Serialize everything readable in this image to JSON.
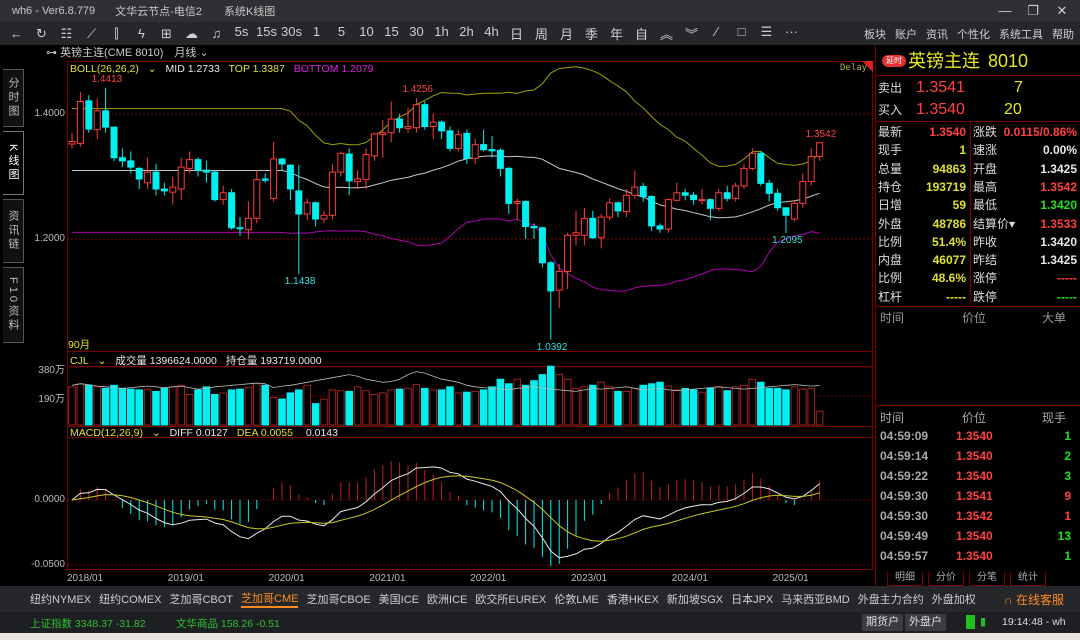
{
  "titlebar": {
    "app": "wh6  -  Ver6.8.779",
    "node": "文华云节点-电信2",
    "window": "系统K线图",
    "minimize": "—",
    "restore": "❐",
    "close": "✕"
  },
  "toolbar": {
    "icons": [
      {
        "name": "back-arrow-icon",
        "glyph": "←"
      },
      {
        "name": "refresh-icon",
        "glyph": "↻"
      },
      {
        "name": "list-icon",
        "glyph": "☷"
      },
      {
        "name": "line-chart-icon",
        "glyph": "⟋"
      },
      {
        "name": "candlestick-icon",
        "glyph": "⫿"
      },
      {
        "name": "lightning-icon",
        "glyph": "ϟ"
      },
      {
        "name": "calculator-icon",
        "glyph": "⊞"
      },
      {
        "name": "cloud-icon",
        "glyph": "☁"
      },
      {
        "name": "bell-icon",
        "glyph": "♫"
      }
    ],
    "periods": [
      "5s",
      "15s",
      "30s",
      "1",
      "5",
      "10",
      "15",
      "30",
      "1h",
      "2h",
      "4h",
      "日",
      "周",
      "月",
      "季",
      "年",
      "自"
    ],
    "tools": [
      {
        "name": "double-up-icon",
        "glyph": "︽"
      },
      {
        "name": "double-down-icon",
        "glyph": "︾"
      },
      {
        "name": "draw-line-icon",
        "glyph": "⁄"
      },
      {
        "name": "rectangle-icon",
        "glyph": "□"
      },
      {
        "name": "layout-icon",
        "glyph": "☰"
      },
      {
        "name": "more-icon",
        "glyph": "···"
      }
    ],
    "menu": [
      "板块",
      "账户",
      "资讯",
      "个性化",
      "系统工具",
      "帮助"
    ]
  },
  "symbol_row": {
    "link_icon": "⊶",
    "name": "英镑主连(CME 8010)",
    "period": "月线"
  },
  "side_tabs": [
    "分时图",
    "K线图",
    "资讯链",
    "F10资料"
  ],
  "chart_data": {
    "type": "candlestick",
    "title": "英镑主连(CME 8010) 月线",
    "period_count_label": "90月",
    "delay_label": "Delay",
    "x_ticks": [
      {
        "i": 0,
        "label": "2018/01"
      },
      {
        "i": 12,
        "label": "2019/01"
      },
      {
        "i": 24,
        "label": "2020/01"
      },
      {
        "i": 36,
        "label": "2021/01"
      },
      {
        "i": 48,
        "label": "2022/01"
      },
      {
        "i": 60,
        "label": "2023/01"
      },
      {
        "i": 72,
        "label": "2024/01"
      },
      {
        "i": 84,
        "label": "2025/01"
      }
    ],
    "price_axis": {
      "ticks": [
        "1.4000",
        "1.2000"
      ],
      "tick_values": [
        1.4,
        1.2
      ]
    },
    "volume_axis": {
      "ticks": [
        "380万",
        "190万"
      ],
      "tick_values": [
        380,
        190
      ]
    },
    "macd_axis": {
      "ticks": [
        "0.0000",
        "-0.0500"
      ],
      "tick_values": [
        0,
        -0.05
      ]
    },
    "boll_legend": {
      "name": "BOLL(26,26,2)",
      "mid": "MID 1.2733",
      "top": "TOP 1.3387",
      "bottom": "BOTTOM 1.2079"
    },
    "vol_legend": {
      "name": "CJL",
      "volume": "成交量 1396624.0000",
      "oi": "持仓量 193719.0000"
    },
    "macd_legend": {
      "name": "MACD(12,26,9)",
      "diff": "DIFF 0.0127",
      "dea": "DEA 0.0055",
      "macd": "0.0143"
    },
    "annotations": [
      {
        "i": 4,
        "label": "1.4413",
        "type": "high"
      },
      {
        "i": 41,
        "label": "1.4256",
        "type": "high"
      },
      {
        "i": 89,
        "label": "1.3542",
        "type": "high"
      },
      {
        "i": 27,
        "label": "1.1438",
        "type": "low"
      },
      {
        "i": 57,
        "label": "1.0392",
        "type": "low"
      },
      {
        "i": 85,
        "label": "1.2095",
        "type": "low"
      }
    ],
    "ohlc": [
      [
        1.352,
        1.37,
        1.345,
        1.356
      ],
      [
        1.353,
        1.435,
        1.348,
        1.42
      ],
      [
        1.421,
        1.43,
        1.37,
        1.376
      ],
      [
        1.375,
        1.425,
        1.36,
        1.405
      ],
      [
        1.405,
        1.4413,
        1.37,
        1.379
      ],
      [
        1.379,
        1.38,
        1.325,
        1.33
      ],
      [
        1.33,
        1.345,
        1.315,
        1.325
      ],
      [
        1.325,
        1.34,
        1.305,
        1.315
      ],
      [
        1.313,
        1.315,
        1.28,
        1.296
      ],
      [
        1.29,
        1.33,
        1.28,
        1.307
      ],
      [
        1.307,
        1.32,
        1.27,
        1.28
      ],
      [
        1.28,
        1.29,
        1.27,
        1.277
      ],
      [
        1.275,
        1.3,
        1.255,
        1.283
      ],
      [
        1.28,
        1.33,
        1.262,
        1.315
      ],
      [
        1.313,
        1.34,
        1.305,
        1.327
      ],
      [
        1.327,
        1.33,
        1.3,
        1.31
      ],
      [
        1.31,
        1.325,
        1.29,
        1.307
      ],
      [
        1.307,
        1.31,
        1.26,
        1.263
      ],
      [
        1.263,
        1.285,
        1.255,
        1.274
      ],
      [
        1.274,
        1.28,
        1.215,
        1.218
      ],
      [
        1.218,
        1.235,
        1.205,
        1.217
      ],
      [
        1.215,
        1.26,
        1.2,
        1.233
      ],
      [
        1.233,
        1.31,
        1.225,
        1.295
      ],
      [
        1.296,
        1.305,
        1.29,
        1.294
      ],
      [
        1.265,
        1.355,
        1.26,
        1.328
      ],
      [
        1.328,
        1.33,
        1.31,
        1.32
      ],
      [
        1.318,
        1.32,
        1.262,
        1.28
      ],
      [
        1.277,
        1.318,
        1.1438,
        1.24
      ],
      [
        1.24,
        1.265,
        1.23,
        1.258
      ],
      [
        1.258,
        1.26,
        1.22,
        1.232
      ],
      [
        1.232,
        1.245,
        1.225,
        1.238
      ],
      [
        1.238,
        1.32,
        1.232,
        1.307
      ],
      [
        1.307,
        1.34,
        1.3,
        1.337
      ],
      [
        1.336,
        1.345,
        1.27,
        1.293
      ],
      [
        1.292,
        1.31,
        1.28,
        1.296
      ],
      [
        1.295,
        1.345,
        1.28,
        1.335
      ],
      [
        1.333,
        1.37,
        1.325,
        1.368
      ],
      [
        1.367,
        1.39,
        1.33,
        1.37
      ],
      [
        1.37,
        1.42,
        1.355,
        1.392
      ],
      [
        1.392,
        1.4,
        1.37,
        1.378
      ],
      [
        1.377,
        1.41,
        1.37,
        1.38
      ],
      [
        1.378,
        1.4256,
        1.37,
        1.415
      ],
      [
        1.415,
        1.42,
        1.375,
        1.38
      ],
      [
        1.38,
        1.4,
        1.36,
        1.387
      ],
      [
        1.387,
        1.39,
        1.36,
        1.373
      ],
      [
        1.373,
        1.38,
        1.34,
        1.345
      ],
      [
        1.345,
        1.375,
        1.34,
        1.367
      ],
      [
        1.369,
        1.375,
        1.32,
        1.329
      ],
      [
        1.329,
        1.36,
        1.32,
        1.351
      ],
      [
        1.351,
        1.375,
        1.34,
        1.343
      ],
      [
        1.343,
        1.365,
        1.33,
        1.341
      ],
      [
        1.342,
        1.345,
        1.3,
        1.313
      ],
      [
        1.313,
        1.315,
        1.24,
        1.257
      ],
      [
        1.257,
        1.265,
        1.23,
        1.26
      ],
      [
        1.26,
        1.262,
        1.2,
        1.22
      ],
      [
        1.22,
        1.225,
        1.2,
        1.218
      ],
      [
        1.218,
        1.22,
        1.155,
        1.162
      ],
      [
        1.162,
        1.165,
        1.0392,
        1.117
      ],
      [
        1.118,
        1.16,
        1.09,
        1.148
      ],
      [
        1.148,
        1.21,
        1.12,
        1.206
      ],
      [
        1.206,
        1.245,
        1.19,
        1.21
      ],
      [
        1.206,
        1.25,
        1.19,
        1.233
      ],
      [
        1.233,
        1.245,
        1.2,
        1.202
      ],
      [
        1.202,
        1.24,
        1.185,
        1.235
      ],
      [
        1.235,
        1.265,
        1.23,
        1.258
      ],
      [
        1.258,
        1.26,
        1.235,
        1.245
      ],
      [
        1.244,
        1.28,
        1.235,
        1.27
      ],
      [
        1.27,
        1.31,
        1.265,
        1.283
      ],
      [
        1.284,
        1.29,
        1.26,
        1.268
      ],
      [
        1.268,
        1.27,
        1.213,
        1.221
      ],
      [
        1.221,
        1.225,
        1.21,
        1.216
      ],
      [
        1.216,
        1.265,
        1.21,
        1.263
      ],
      [
        1.262,
        1.29,
        1.26,
        1.274
      ],
      [
        1.274,
        1.28,
        1.262,
        1.27
      ],
      [
        1.27,
        1.275,
        1.255,
        1.263
      ],
      [
        1.262,
        1.28,
        1.255,
        1.263
      ],
      [
        1.263,
        1.265,
        1.23,
        1.249
      ],
      [
        1.249,
        1.28,
        1.245,
        1.274
      ],
      [
        1.274,
        1.285,
        1.26,
        1.265
      ],
      [
        1.265,
        1.29,
        1.26,
        1.285
      ],
      [
        1.285,
        1.32,
        1.28,
        1.313
      ],
      [
        1.313,
        1.345,
        1.31,
        1.337
      ],
      [
        1.337,
        1.34,
        1.285,
        1.289
      ],
      [
        1.289,
        1.295,
        1.26,
        1.273
      ],
      [
        1.273,
        1.28,
        1.245,
        1.25
      ],
      [
        1.25,
        1.25,
        1.2095,
        1.238
      ],
      [
        1.232,
        1.262,
        1.228,
        1.257
      ],
      [
        1.257,
        1.305,
        1.25,
        1.292
      ],
      [
        1.292,
        1.345,
        1.285,
        1.332
      ],
      [
        1.332,
        1.3542,
        1.325,
        1.354
      ]
    ],
    "volume_wan": [
      250,
      270,
      260,
      250,
      240,
      260,
      240,
      235,
      230,
      235,
      220,
      240,
      250,
      260,
      200,
      230,
      250,
      200,
      210,
      230,
      235,
      245,
      270,
      260,
      180,
      170,
      210,
      230,
      260,
      140,
      170,
      230,
      225,
      220,
      250,
      225,
      200,
      210,
      230,
      235,
      240,
      265,
      240,
      230,
      230,
      250,
      210,
      215,
      220,
      230,
      250,
      300,
      270,
      300,
      260,
      290,
      330,
      385,
      330,
      300,
      240,
      250,
      260,
      280,
      250,
      220,
      220,
      240,
      260,
      270,
      280,
      255,
      230,
      240,
      230,
      215,
      240,
      250,
      225,
      250,
      260,
      300,
      280,
      240,
      240,
      230,
      250,
      235,
      240,
      90
    ],
    "open_interest_wan": [
      260,
      270,
      265,
      255,
      250,
      245,
      240,
      245,
      250,
      255,
      250,
      245,
      250,
      255,
      245,
      235,
      240,
      250,
      255,
      260,
      265,
      270,
      275,
      270,
      245,
      255,
      260,
      270,
      280,
      290,
      300,
      310,
      320,
      330,
      320,
      300,
      290,
      280,
      285,
      300,
      330,
      350,
      340,
      320,
      300,
      290,
      280,
      260,
      250,
      245,
      240,
      235,
      230,
      240,
      245,
      250,
      240,
      235,
      230,
      225,
      220,
      230,
      240,
      235,
      240,
      245,
      250,
      240,
      230,
      235,
      240,
      230,
      225,
      230,
      235,
      240,
      245,
      250,
      245,
      240,
      235,
      240,
      245,
      250,
      255,
      260,
      265,
      260,
      255,
      260
    ]
  },
  "quote": {
    "badge": "延时",
    "name": "英镑主连",
    "code": "8010",
    "ask_label": "卖出",
    "ask_price": "1.3541",
    "ask_qty": "7",
    "bid_label": "买入",
    "bid_price": "1.3540",
    "bid_qty": "20",
    "stats": [
      {
        "l1": "最新",
        "v1": "1.3540",
        "c1": "#ff4040",
        "l2": "涨跌",
        "v2": "0.0115/0.86%",
        "c2": "#ff4040"
      },
      {
        "l1": "现手",
        "v1": "1",
        "c1": "#e0e030",
        "l2": "速涨",
        "v2": "0.00%",
        "c2": "#e8e8e8"
      },
      {
        "l1": "总量",
        "v1": "94863",
        "c1": "#e0e030",
        "l2": "开盘",
        "v2": "1.3425",
        "c2": "#e8e8e8"
      },
      {
        "l1": "持仓",
        "v1": "193719",
        "c1": "#e0e030",
        "l2": "最高",
        "v2": "1.3542",
        "c2": "#ff4040"
      },
      {
        "l1": "日增",
        "v1": "59",
        "c1": "#e0e030",
        "l2": "最低",
        "v2": "1.3420",
        "c2": "#20e020"
      },
      {
        "l1": "外盘",
        "v1": "48786",
        "c1": "#e0e030",
        "l2": "结算价▾",
        "v2": "1.3533",
        "c2": "#ff4040"
      },
      {
        "l1": "比例",
        "v1": "51.4%",
        "c1": "#e0e030",
        "l2": "昨收",
        "v2": "1.3420",
        "c2": "#e8e8e8"
      },
      {
        "l1": "内盘",
        "v1": "46077",
        "c1": "#e0e030",
        "l2": "昨结",
        "v2": "1.3425",
        "c2": "#e8e8e8"
      },
      {
        "l1": "比例",
        "v1": "48.6%",
        "c1": "#e0e030",
        "l2": "涨停",
        "v2": "-----",
        "c2": "#ff4040"
      },
      {
        "l1": "杠杆",
        "v1": "-----",
        "c1": "#e0e030",
        "l2": "跌停",
        "v2": "-----",
        "c2": "#20e020"
      }
    ],
    "big_header": [
      "时间",
      "价位",
      "大单"
    ],
    "ticks_header": [
      "时间",
      "价位",
      "现手"
    ],
    "ticks": [
      {
        "time": "04:59:09",
        "price": "1.3540",
        "qty": "1",
        "qc": "#20e020"
      },
      {
        "time": "04:59:14",
        "price": "1.3540",
        "qty": "2",
        "qc": "#20e020"
      },
      {
        "time": "04:59:22",
        "price": "1.3540",
        "qty": "3",
        "qc": "#20e020"
      },
      {
        "time": "04:59:30",
        "price": "1.3541",
        "qty": "9",
        "qc": "#ff4040"
      },
      {
        "time": "04:59:30",
        "price": "1.3542",
        "qty": "1",
        "qc": "#ff4040"
      },
      {
        "time": "04:59:49",
        "price": "1.3540",
        "qty": "13",
        "qc": "#20e020"
      },
      {
        "time": "04:59:57",
        "price": "1.3540",
        "qty": "1",
        "qc": "#20e020"
      }
    ],
    "bottom_tabs": [
      "明细",
      "分价",
      "分笔",
      "统计"
    ]
  },
  "exchanges": {
    "items": [
      "纽约NYMEX",
      "纽约COMEX",
      "芝加哥CBOT",
      "芝加哥CME",
      "芝加哥CBOE",
      "美国ICE",
      "欧洲ICE",
      "欧交所EUREX",
      "伦敦LME",
      "香港HKEX",
      "新加坡SGX",
      "日本JPX",
      "马来西亚BMD",
      "外盘主力合约",
      "外盘加权"
    ],
    "active": 3,
    "support": "在线客服"
  },
  "status": {
    "idx1": "上证指数  3348.37  -31.82",
    "idx2": "文华商品  158.26  -0.51",
    "btn1": "期货户",
    "btn2": "外盘户",
    "clock": "19:14:48 - wh"
  },
  "colors": {
    "up": "#ff3b3b",
    "down": "#00f0f0",
    "mid": "#c8c8c8",
    "top": "#a0a000",
    "bottom": "#b000b0",
    "grid": "#7a0000"
  }
}
